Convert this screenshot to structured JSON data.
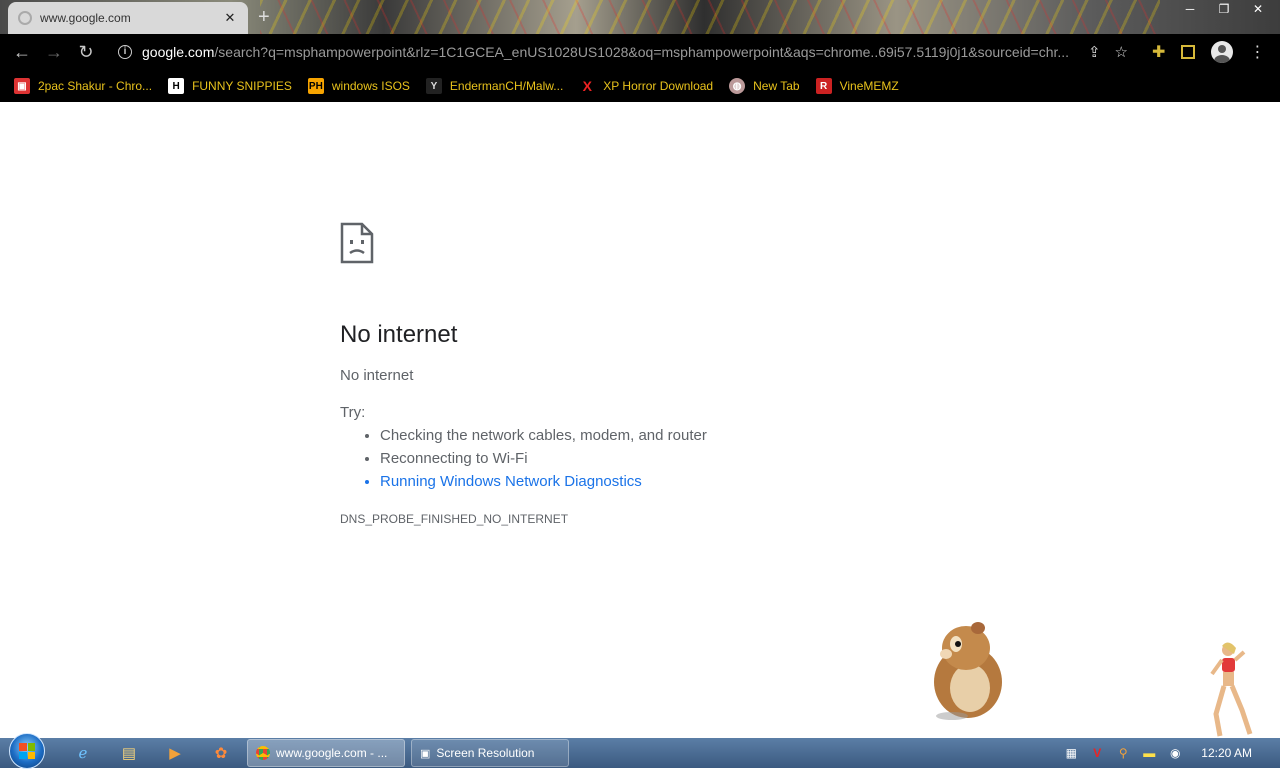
{
  "browser": {
    "tab_title": "www.google.com",
    "url_host": "google.com",
    "url_rest": "/search?q=msphampowerpoint&rlz=1C1GCEA_enUS1028US1028&oq=msphampowerpoint&aqs=chrome..69i57.5119j0j1&sourceid=chr..."
  },
  "bookmarks": [
    {
      "label": "2pac Shakur - Chro...",
      "icon": "tupac-icon"
    },
    {
      "label": "FUNNY SNIPPIES",
      "icon": "h-icon"
    },
    {
      "label": "windows ISOS",
      "icon": "ph-icon"
    },
    {
      "label": "EndermanCH/Malw...",
      "icon": "yp-icon"
    },
    {
      "label": "XP Horror Download",
      "icon": "x-icon"
    },
    {
      "label": "New Tab",
      "icon": "globe-icon"
    },
    {
      "label": "VineMEMZ",
      "icon": "r-icon"
    }
  ],
  "error": {
    "title": "No internet",
    "subtitle": "No internet",
    "try_label": "Try:",
    "suggestions": [
      "Checking the network cables, modem, and router",
      "Reconnecting to Wi-Fi",
      "Running Windows Network Diagnostics"
    ],
    "code": "DNS_PROBE_FINISHED_NO_INTERNET"
  },
  "taskbar": {
    "buttons": [
      "www.google.com - ...",
      "Screen Resolution"
    ],
    "clock": "12:20 AM"
  },
  "colors": {
    "bookmark_text": "#e8c21c",
    "link": "#1a73e8",
    "taskbar": "#3b5a80"
  }
}
